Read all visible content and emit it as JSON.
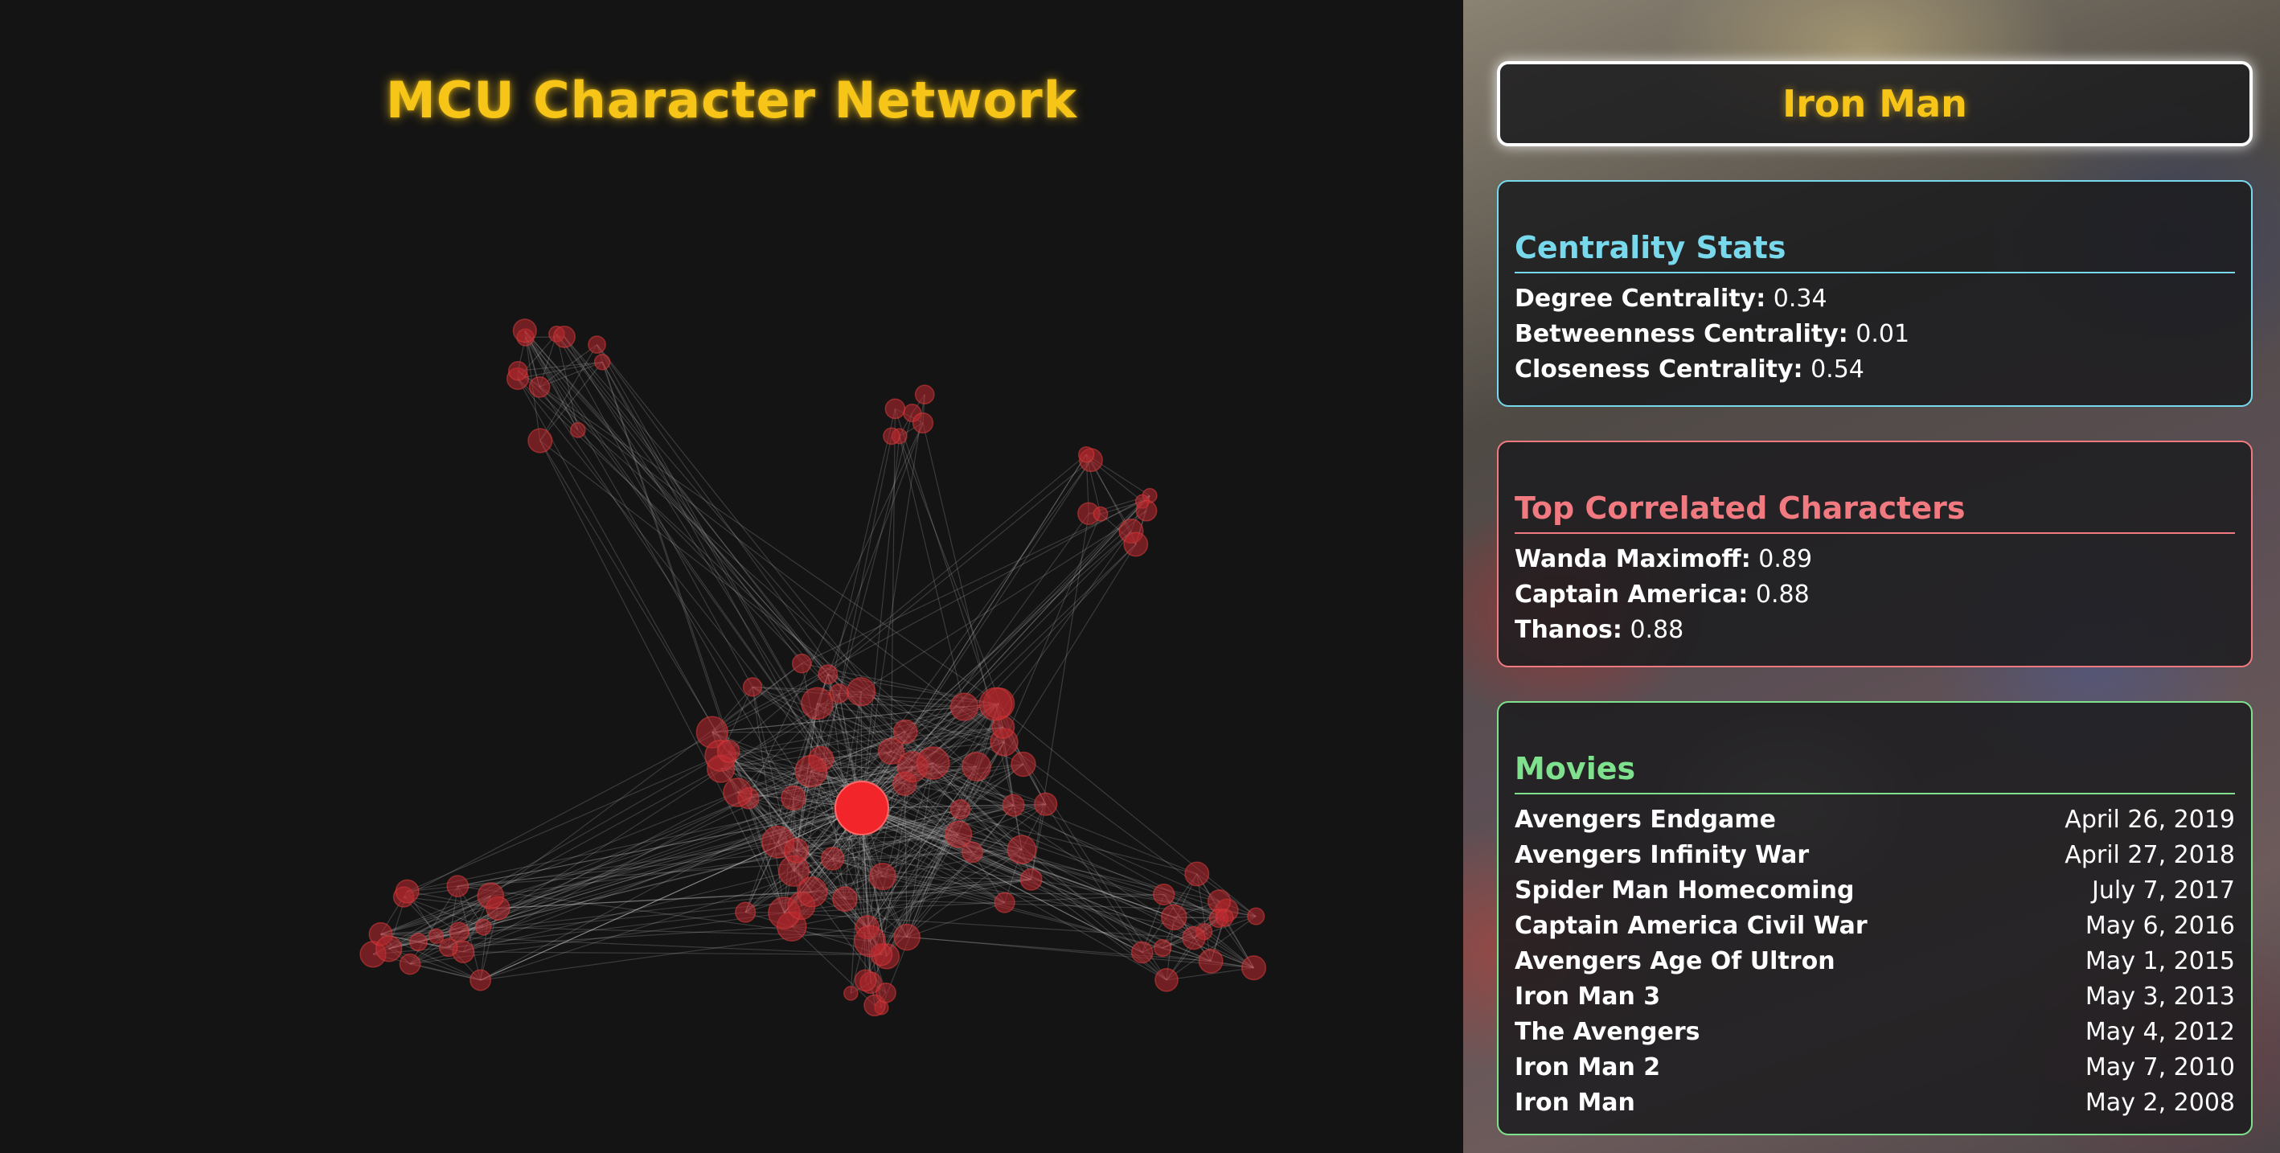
{
  "graph": {
    "title": "MCU Character Network"
  },
  "selected": {
    "name": "Iron Man"
  },
  "centrality": {
    "title": "Centrality Stats",
    "stats": [
      {
        "label": "Degree Centrality:",
        "value": "0.34"
      },
      {
        "label": "Betweenness Centrality:",
        "value": "0.01"
      },
      {
        "label": "Closeness Centrality:",
        "value": "0.54"
      }
    ]
  },
  "correlated": {
    "title": "Top Correlated Characters",
    "items": [
      {
        "name": "Wanda Maximoff:",
        "value": "0.89"
      },
      {
        "name": "Captain America:",
        "value": "0.88"
      },
      {
        "name": "Thanos:",
        "value": "0.88"
      }
    ]
  },
  "movies": {
    "title": "Movies",
    "items": [
      {
        "title": "Avengers Endgame",
        "date": "April 26, 2019"
      },
      {
        "title": "Avengers Infinity War",
        "date": "April 27, 2018"
      },
      {
        "title": "Spider Man Homecoming",
        "date": "July 7, 2017"
      },
      {
        "title": "Captain America Civil War",
        "date": "May 6, 2016"
      },
      {
        "title": "Avengers Age Of Ultron",
        "date": "May 1, 2015"
      },
      {
        "title": "Iron Man 3",
        "date": "May 3, 2013"
      },
      {
        "title": "The Avengers",
        "date": "May 4, 2012"
      },
      {
        "title": "Iron Man 2",
        "date": "May 7, 2010"
      },
      {
        "title": "Iron Man",
        "date": "May 2, 2008"
      }
    ]
  },
  "colors": {
    "title_gold": "#f6c518",
    "node_red": "#f2262a",
    "centrality_cyan": "#78d8ec",
    "correlated_pink": "#f07a80",
    "movies_green": "#7fe08e"
  }
}
